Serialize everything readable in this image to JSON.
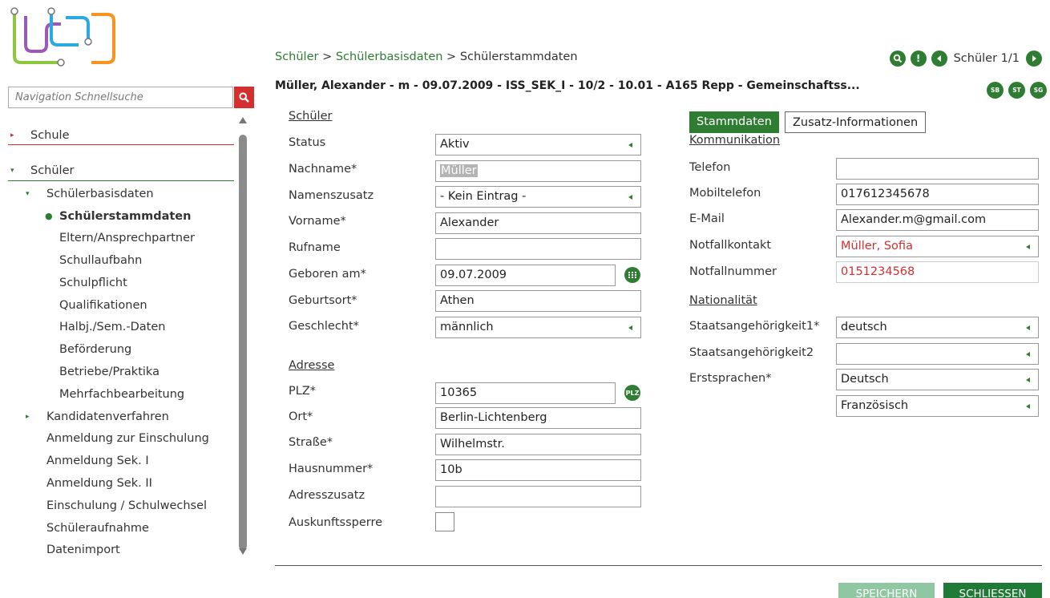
{
  "sidebar": {
    "search_placeholder": "Navigation Schnellsuche",
    "nav": [
      {
        "label": "Schule",
        "marker": "▸"
      },
      {
        "label": "Schüler",
        "marker": "▾"
      },
      {
        "label": "Schülerbasisdaten",
        "marker": "▾"
      },
      {
        "label": "Schülerstammdaten",
        "marker": "●"
      },
      {
        "label": "Eltern/Ansprechpartner",
        "marker": ""
      },
      {
        "label": "Schullaufbahn",
        "marker": ""
      },
      {
        "label": "Schulpflicht",
        "marker": ""
      },
      {
        "label": "Qualifikationen",
        "marker": ""
      },
      {
        "label": "Halbj./Sem.-Daten",
        "marker": ""
      },
      {
        "label": "Beförderung",
        "marker": ""
      },
      {
        "label": "Betriebe/Praktika",
        "marker": ""
      },
      {
        "label": "Mehrfachbearbeitung",
        "marker": ""
      },
      {
        "label": "Kandidatenverfahren",
        "marker": "▸"
      },
      {
        "label": "Anmeldung zur Einschulung",
        "marker": ""
      },
      {
        "label": "Anmeldung Sek. I",
        "marker": ""
      },
      {
        "label": "Anmeldung Sek. II",
        "marker": ""
      },
      {
        "label": "Einschulung / Schulwechsel",
        "marker": ""
      },
      {
        "label": "Schüleraufnahme",
        "marker": ""
      },
      {
        "label": "Datenimport",
        "marker": ""
      }
    ]
  },
  "header": {
    "breadcrumb": {
      "part1": "Schüler",
      "sep1": " > ",
      "part2": "Schülerbasisdaten",
      "sep2": " > ",
      "current": "Schülerstammdaten"
    },
    "student_title": "Müller, Alexander - m - 09.07.2009 - ISS_SEK_I - 10/2 - 10.01 - A165 Repp - Gemeinschaftss...",
    "pager_label": "Schüler 1/1",
    "badges": [
      "SB",
      "ST",
      "SG"
    ]
  },
  "form": {
    "schueler_title": "Schüler",
    "adresse_title": "Adresse",
    "labels": {
      "status": "Status",
      "nachname": "Nachname*",
      "namenszusatz": "Namenszusatz",
      "vorname": "Vorname*",
      "rufname": "Rufname",
      "geboren": "Geboren am*",
      "geburtsort": "Geburtsort*",
      "geschlecht": "Geschlecht*",
      "plz": "PLZ*",
      "ort": "Ort*",
      "strasse": "Straße*",
      "hausnummer": "Hausnummer*",
      "adresszusatz": "Adresszusatz",
      "auskunftssperre": "Auskunftssperre"
    },
    "values": {
      "status": "Aktiv",
      "nachname": "Müller",
      "namenszusatz": "- Kein Eintrag -",
      "vorname": "Alexander",
      "rufname": "",
      "geboren": "09.07.2009",
      "geburtsort": "Athen",
      "geschlecht": "männlich",
      "plz": "10365",
      "ort": "Berlin-Lichtenberg",
      "strasse": "Wilhelmstr.",
      "hausnummer": "10b",
      "adresszusatz": ""
    },
    "plz_button": "PLZ",
    "auskunftssperre_checked": false
  },
  "tabs": {
    "stammdaten": "Stammdaten",
    "zusatz": "Zusatz-Informationen"
  },
  "kommunikation": {
    "title": "Kommunikation",
    "labels": {
      "telefon": "Telefon",
      "mobil": "Mobiltelefon",
      "email": "E-Mail",
      "notfallkontakt": "Notfallkontakt",
      "notfallnummer": "Notfallnummer"
    },
    "values": {
      "telefon": "",
      "mobil": "017612345678",
      "email": "Alexander.m@gmail.com",
      "notfallkontakt": "Müller, Sofia",
      "notfallnummer": "0151234568"
    }
  },
  "nationalitaet": {
    "title": "Nationalität",
    "labels": {
      "staat1": "Staatsangehörigkeit1*",
      "staat2": "Staatsangehörigkeit2",
      "erstsprachen": "Erstsprachen*"
    },
    "values": {
      "staat1": "deutsch",
      "staat2": "",
      "sprache1": "Deutsch",
      "sprache2": "Französisch"
    }
  },
  "buttons": {
    "save": "SPEICHERN",
    "close": "SCHLIESSEN"
  },
  "colors": {
    "accent": "#2e7d32",
    "danger": "#d32f2f",
    "save_disabled": "#8ec7a2"
  }
}
